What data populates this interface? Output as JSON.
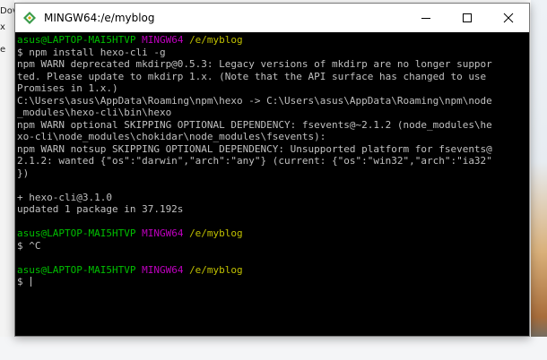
{
  "background": {
    "snippets": [
      "Dov",
      "x",
      "e"
    ]
  },
  "window": {
    "title": "MINGW64:/e/myblog",
    "icon": "mingw-diamond-icon",
    "accent": "#2ea043"
  },
  "terminal": {
    "lines": [
      [
        {
          "t": "asus@LAPTOP-MAI5HTVP",
          "c": "green"
        },
        {
          "t": " "
        },
        {
          "t": "MINGW64",
          "c": "magenta"
        },
        {
          "t": " "
        },
        {
          "t": "/e/myblog",
          "c": "yellow"
        }
      ],
      [
        {
          "t": "$ npm install hexo-cli -g"
        }
      ],
      [
        {
          "t": "npm WARN deprecated mkdirp@0.5.3: Legacy versions of mkdirp are no longer suppor"
        }
      ],
      [
        {
          "t": "ted. Please update to mkdirp 1.x. (Note that the API surface has changed to use"
        }
      ],
      [
        {
          "t": "Promises in 1.x.)"
        }
      ],
      [
        {
          "t": "C:\\Users\\asus\\AppData\\Roaming\\npm\\hexo -> C:\\Users\\asus\\AppData\\Roaming\\npm\\node"
        }
      ],
      [
        {
          "t": "_modules\\hexo-cli\\bin\\hexo"
        }
      ],
      [
        {
          "t": "npm WARN optional SKIPPING OPTIONAL DEPENDENCY: fsevents@~2.1.2 (node_modules\\he"
        }
      ],
      [
        {
          "t": "xo-cli\\node_modules\\chokidar\\node_modules\\fsevents):"
        }
      ],
      [
        {
          "t": "npm WARN notsup SKIPPING OPTIONAL DEPENDENCY: Unsupported platform for fsevents@"
        }
      ],
      [
        {
          "t": "2.1.2: wanted {\"os\":\"darwin\",\"arch\":\"any\"} (current: {\"os\":\"win32\",\"arch\":\"ia32\""
        }
      ],
      [
        {
          "t": "})"
        }
      ],
      [
        {
          "t": ""
        }
      ],
      [
        {
          "t": "+ hexo-cli@3.1.0"
        }
      ],
      [
        {
          "t": "updated 1 package in 37.192s"
        }
      ],
      [
        {
          "t": ""
        }
      ],
      [
        {
          "t": "asus@LAPTOP-MAI5HTVP",
          "c": "green"
        },
        {
          "t": " "
        },
        {
          "t": "MINGW64",
          "c": "magenta"
        },
        {
          "t": " "
        },
        {
          "t": "/e/myblog",
          "c": "yellow"
        }
      ],
      [
        {
          "t": "$ ^C"
        }
      ],
      [
        {
          "t": ""
        }
      ],
      [
        {
          "t": "asus@LAPTOP-MAI5HTVP",
          "c": "green"
        },
        {
          "t": " "
        },
        {
          "t": "MINGW64",
          "c": "magenta"
        },
        {
          "t": " "
        },
        {
          "t": "/e/myblog",
          "c": "yellow"
        }
      ],
      [
        {
          "t": "$ "
        }
      ]
    ],
    "colors": {
      "green": "#00c000",
      "magenta": "#c000c0",
      "yellow": "#c0c000",
      "text": "#c0c0c0",
      "background": "#000000"
    }
  }
}
